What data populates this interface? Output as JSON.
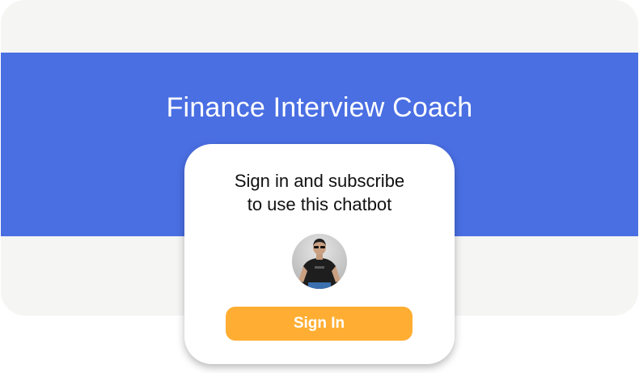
{
  "banner": {
    "title": "Finance Interview Coach"
  },
  "signin_card": {
    "message_line1": "Sign in and subscribe",
    "message_line2": "to use this chatbot",
    "button_label": "Sign In"
  },
  "colors": {
    "banner_blue": "#4a6fe3",
    "page_gray": "#f5f5f4",
    "button_orange": "#ffae33"
  }
}
